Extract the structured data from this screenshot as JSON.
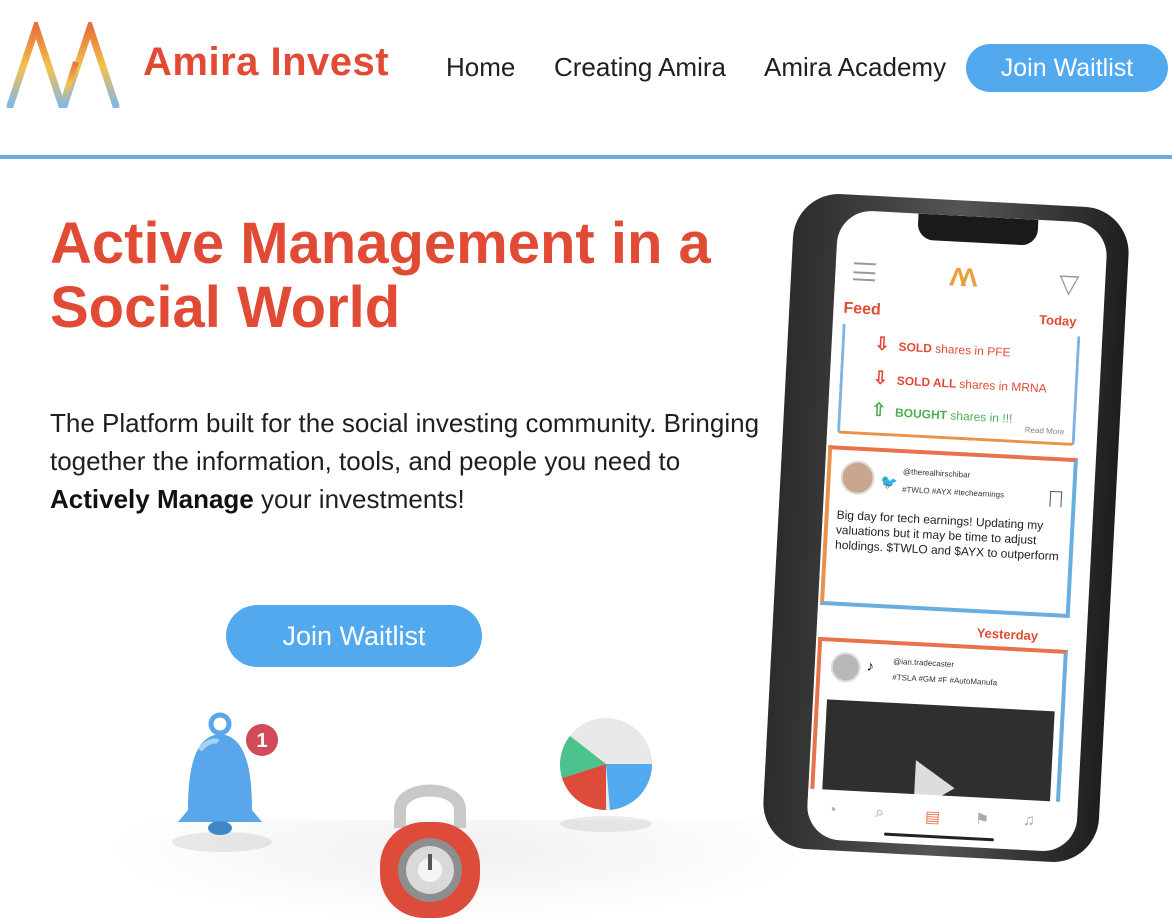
{
  "header": {
    "brand": "Amira Invest",
    "nav": [
      "Home",
      "Creating Amira",
      "Amira Academy"
    ],
    "cta": "Join Waitlist"
  },
  "hero": {
    "headline": "Active Management in a Social World",
    "sub_1": "The Platform built for the social investing community. Bringing together the information, tools, and people you need to",
    "sub_bold": "Actively Manage",
    "sub_2": "your investments!",
    "cta": "Join Waitlist"
  },
  "decor": {
    "bell_badge": "1"
  },
  "phone": {
    "feed": "Feed",
    "today": "Today",
    "trades": [
      {
        "action": "SOLD",
        "rest": "shares in PFE",
        "color": "#e14b35"
      },
      {
        "action": "SOLD ALL",
        "rest": "shares in MRNA",
        "color": "#e14b35"
      },
      {
        "action": "BOUGHT",
        "rest": "shares in !!!",
        "color": "#4caf50"
      }
    ],
    "read_more": "Read More",
    "post1": {
      "handle": "@therealhirschibar",
      "tags": "#TWLO #AYX #techearnings",
      "text": "Big day for tech earnings! Updating my valuations but it may be time to adjust holdings. $TWLO and $AYX to outperform"
    },
    "yesterday": "Yesterday",
    "post2": {
      "handle": "@ian.tradecaster",
      "tags": "#TSLA #GM #F #AutoManufa"
    }
  },
  "colors": {
    "brand_red": "#e14b35",
    "accent_blue": "#52a9ee",
    "divider": "#6aaee0"
  }
}
